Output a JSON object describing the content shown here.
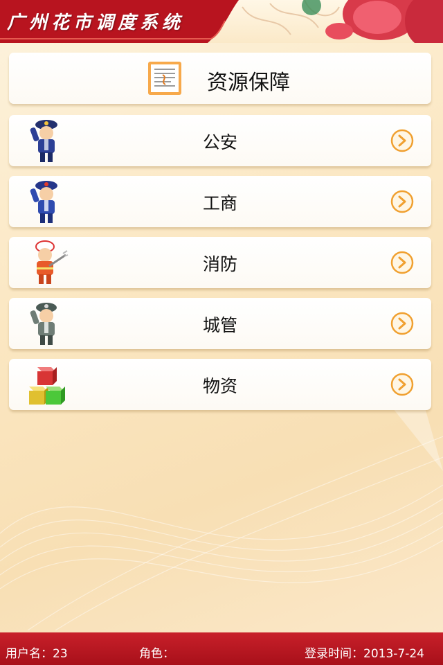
{
  "header": {
    "title": "广州花市调度系统"
  },
  "category_card": {
    "label": "资源保障",
    "icon": "document-icon"
  },
  "items": [
    {
      "label": "公安",
      "icon": "police-officer-icon"
    },
    {
      "label": "工商",
      "icon": "commerce-officer-icon"
    },
    {
      "label": "消防",
      "icon": "firefighter-icon"
    },
    {
      "label": "城管",
      "icon": "urban-management-officer-icon"
    },
    {
      "label": "物资",
      "icon": "supplies-boxes-icon"
    }
  ],
  "footer": {
    "user_label": "用户名：23",
    "role_label": "角色：",
    "login_label": "登录时间：2013-7-24"
  },
  "colors": {
    "brand_red": "#b8141f",
    "arrow_orange": "#f0a030"
  }
}
